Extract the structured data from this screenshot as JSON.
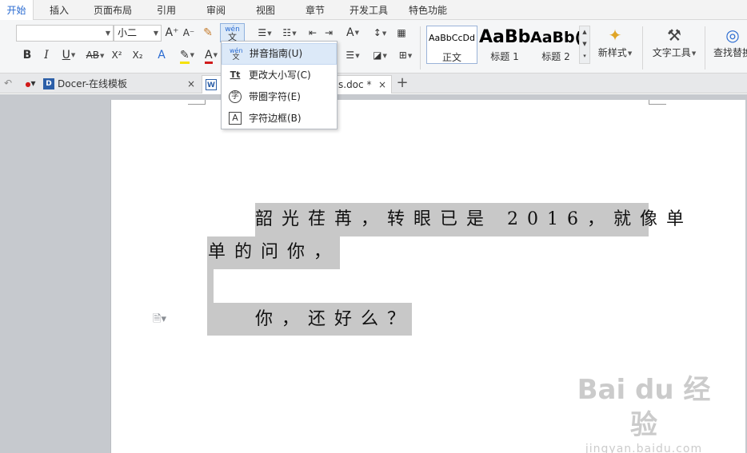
{
  "menu_tabs": [
    "开始",
    "插入",
    "页面布局",
    "引用",
    "审阅",
    "视图",
    "章节",
    "开发工具",
    "特色功能"
  ],
  "ribbon": {
    "font_name": "",
    "font_size": "小二",
    "grow_font": "A⁺",
    "shrink_font": "A⁻",
    "bold": "B",
    "italic": "I",
    "underline": "U",
    "strikethrough": "AB",
    "superscript": "X²",
    "subscript": "X₂",
    "pinyin_top": "wén",
    "pinyin_bottom": "文",
    "styles": [
      {
        "preview": "AaBbCcDd",
        "name": "正文"
      },
      {
        "preview": "AaBb",
        "name": "标题 1"
      },
      {
        "preview": "AaBb(",
        "name": "标题 2"
      }
    ],
    "new_style": "新样式",
    "text_tools": "文字工具",
    "find_replace": "查找替换"
  },
  "doc_tabs": [
    {
      "icon": "D",
      "label": "Docer-在线模板"
    },
    {
      "icon": "W",
      "label": "s.doc *"
    }
  ],
  "dropdown": [
    {
      "icon": "wén\n文",
      "label": "拼音指南(U)"
    },
    {
      "icon": "Tt",
      "label": "更改大小写(C)"
    },
    {
      "icon": "字",
      "label": "带圈字符(E)"
    },
    {
      "icon": "A",
      "label": "字符边框(B)"
    }
  ],
  "document": {
    "line1": "韶光荏苒，转眼已是 2016，就像单",
    "line2": "单的问你，",
    "line3": "你，还好么？"
  },
  "watermark": {
    "main": "Bai du 经验",
    "sub": "jingyan.baidu.com"
  }
}
